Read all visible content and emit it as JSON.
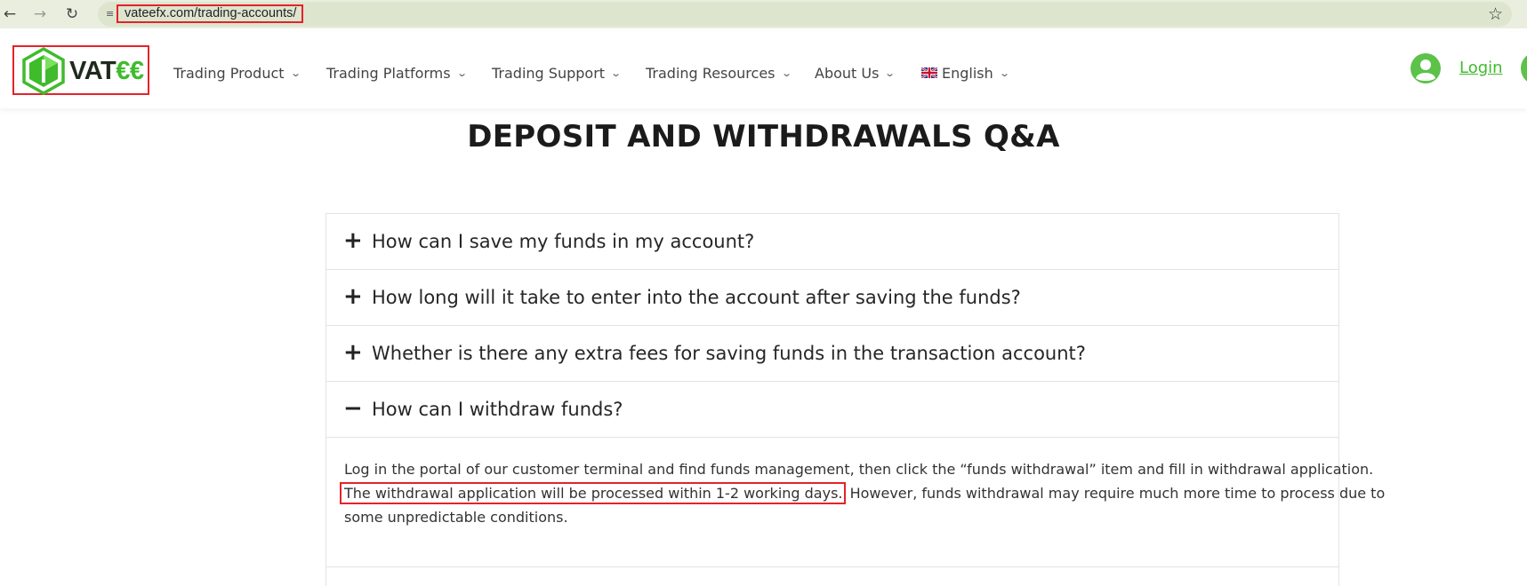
{
  "browser": {
    "url": "vateefx.com/trading-accounts/",
    "back_icon": "arrow-left-icon",
    "forward_icon": "arrow-right-icon",
    "reload_icon": "reload-icon",
    "bookmark_icon": "star-icon"
  },
  "header": {
    "logo": {
      "prefix": "VAT",
      "accent": "€€",
      "brand_color": "#3fbb2c"
    },
    "nav": [
      {
        "label": "Trading Product"
      },
      {
        "label": "Trading Platforms"
      },
      {
        "label": "Trading Support"
      },
      {
        "label": "Trading Resources"
      },
      {
        "label": "About Us"
      },
      {
        "label": "English",
        "icon": "uk-flag-icon"
      }
    ],
    "login_label": "Login"
  },
  "page": {
    "title": "DEPOSIT AND WITHDRAWALS Q&A",
    "faq": [
      {
        "question": "How can I save my funds in my account?",
        "expanded": false,
        "toggle": "+"
      },
      {
        "question": "How long will it take to enter into the account after saving the funds?",
        "expanded": false,
        "toggle": "+"
      },
      {
        "question": "Whether is there any extra fees for saving funds in the transaction account?",
        "expanded": false,
        "toggle": "+"
      },
      {
        "question": "How can I withdraw funds?",
        "expanded": true,
        "toggle": "−"
      }
    ],
    "answer": {
      "line1": "Log in the portal of our customer terminal and find funds management, then click the “funds withdrawal” item and fill in withdrawal application.",
      "highlight": "The withdrawal application will be processed within 1-2 working days.",
      "line2_rest": " However, funds withdrawal may require much more time to process due to",
      "line3": "some unpredictable conditions."
    }
  },
  "colors": {
    "accent_green": "#3fbb2c",
    "annotation_red": "#e5222b",
    "chrome_bg": "#e9eedf"
  }
}
